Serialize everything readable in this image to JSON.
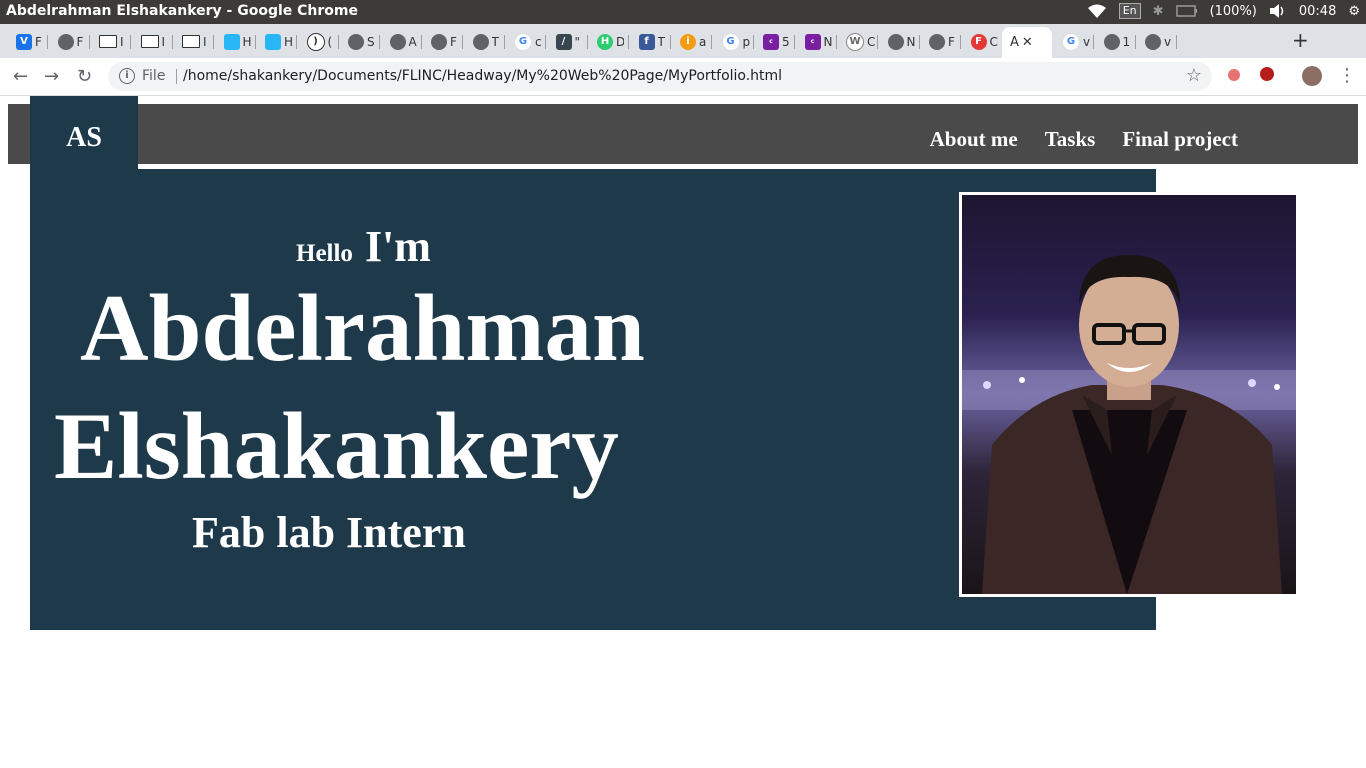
{
  "os": {
    "window_title": "Abdelrahman Elshakankery - Google Chrome",
    "keyboard": "En",
    "battery": "(100%)",
    "clock": "00:48"
  },
  "tabs": [
    {
      "icon": "v-icon",
      "label": "F"
    },
    {
      "icon": "globe-icon",
      "label": "F"
    },
    {
      "icon": "book-icon",
      "label": "I"
    },
    {
      "icon": "book-icon",
      "label": "I"
    },
    {
      "icon": "book-icon",
      "label": "I"
    },
    {
      "icon": "graduation-cap-icon",
      "label": "H"
    },
    {
      "icon": "graduation-cap-icon",
      "label": "H"
    },
    {
      "icon": "speaker-icon",
      "label": "("
    },
    {
      "icon": "globe-icon",
      "label": "S"
    },
    {
      "icon": "globe-icon",
      "label": "A"
    },
    {
      "icon": "globe-icon",
      "label": "F"
    },
    {
      "icon": "globe-icon",
      "label": "T"
    },
    {
      "icon": "google-icon",
      "label": "c"
    },
    {
      "icon": "pen-icon",
      "label": "\""
    },
    {
      "icon": "h-icon",
      "label": "D"
    },
    {
      "icon": "facebook-icon",
      "label": "T"
    },
    {
      "icon": "info-icon",
      "label": "a"
    },
    {
      "icon": "google-icon",
      "label": "p"
    },
    {
      "icon": "colorlib-icon",
      "label": "5"
    },
    {
      "icon": "colorlib-icon",
      "label": "N"
    },
    {
      "icon": "wordpress-icon",
      "label": "C"
    },
    {
      "icon": "globe-icon",
      "label": "N"
    },
    {
      "icon": "globe-icon",
      "label": "F"
    },
    {
      "icon": "f-icon",
      "label": "C"
    },
    {
      "icon": "none",
      "label": "A",
      "active": true
    },
    {
      "icon": "google-icon",
      "label": "v"
    },
    {
      "icon": "globe-icon",
      "label": "1"
    },
    {
      "icon": "globe-icon",
      "label": "v"
    }
  ],
  "address": {
    "scheme_label": "File",
    "url": "/home/shakankery/Documents/FLINC/Headway/My%20Web%20Page/MyPortfolio.html"
  },
  "site": {
    "logo": "AS",
    "nav": [
      "About me",
      "Tasks",
      "Final project"
    ],
    "greeting_small": "Hello",
    "greeting_big": "I'm",
    "first_name": "Abdelrahman",
    "last_name": "Elshakankery",
    "role": "Fab lab Intern",
    "colors": {
      "navbar": "#4a4a4a",
      "hero": "#1e3a4a",
      "text": "#ffffff"
    }
  }
}
